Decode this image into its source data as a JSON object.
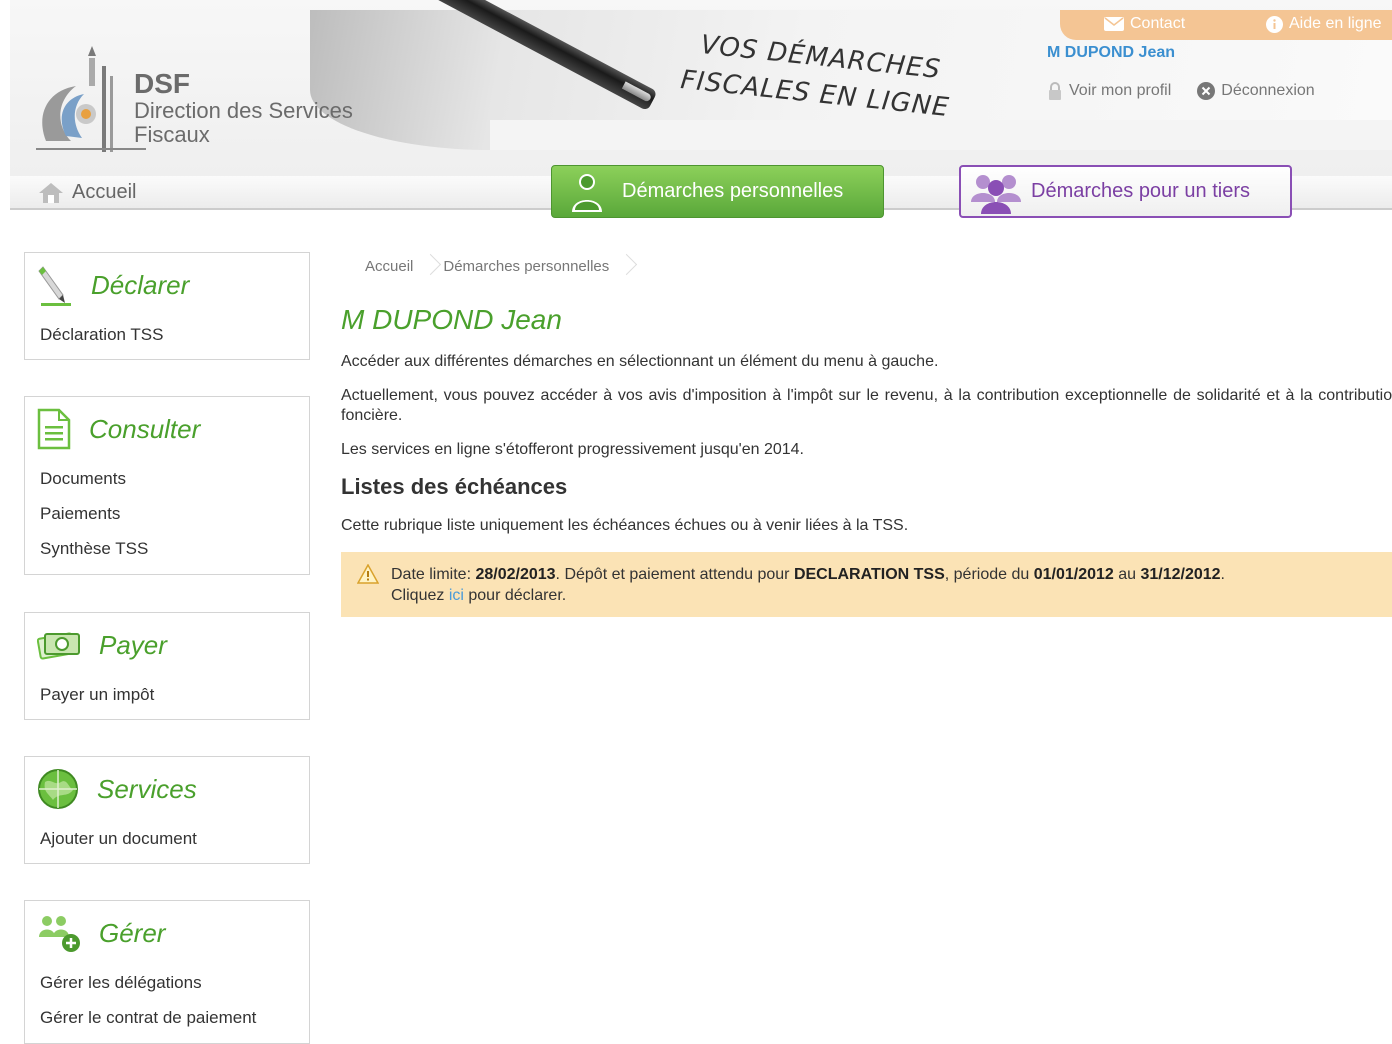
{
  "header": {
    "logo_abbr": "DSF",
    "logo_line1": "Direction des Services",
    "logo_line2": "Fiscaux",
    "slogan_line1": "VOS DÉMARCHES",
    "slogan_line2": "FISCALES EN LIGNE",
    "contact_label": "Contact",
    "help_label": "Aide en ligne",
    "user_name": "M DUPOND Jean",
    "profile_label": "Voir mon profil",
    "logout_label": "Déconnexion"
  },
  "nav": {
    "home_label": "Accueil",
    "perso_label": "Démarches personnelles",
    "tiers_label": "Démarches pour un tiers"
  },
  "sidebar": {
    "declarer": {
      "title": "Déclarer",
      "items": [
        "Déclaration TSS"
      ]
    },
    "consulter": {
      "title": "Consulter",
      "items": [
        "Documents",
        "Paiements",
        "Synthèse TSS"
      ]
    },
    "payer": {
      "title": "Payer",
      "items": [
        "Payer un impôt"
      ]
    },
    "services": {
      "title": "Services",
      "items": [
        "Ajouter un document"
      ]
    },
    "gerer": {
      "title": "Gérer",
      "items": [
        "Gérer les délégations",
        "Gérer le contrat de paiement"
      ]
    }
  },
  "main": {
    "breadcrumb": [
      "Accueil",
      "Démarches personnelles"
    ],
    "title": "M DUPOND Jean",
    "intro": "Accéder aux différentes démarches en sélectionnant un élément du menu à gauche.",
    "actuel": "Actuellement, vous pouvez accéder à vos avis d'imposition à l'impôt sur le revenu, à la contribution exceptionnelle de solidarité et à la contribution foncière.",
    "progress": "Les services en ligne s'étofferont progressivement jusqu'en 2014.",
    "section_title": "Listes des échéances",
    "section_desc": "Cette rubrique liste uniquement les échéances échues ou à venir liées à la TSS.",
    "alert": {
      "prefix": "Date limite: ",
      "date": "28/02/2013",
      "mid1": ". Dépôt et paiement attendu pour ",
      "decl": "DECLARATION TSS",
      "mid2": ", période du ",
      "from": "01/01/2012",
      "mid3": " au ",
      "to": "31/12/2012",
      "end": ".",
      "click_prefix": "Cliquez ",
      "link": "ici",
      "click_suffix": " pour déclarer."
    }
  }
}
